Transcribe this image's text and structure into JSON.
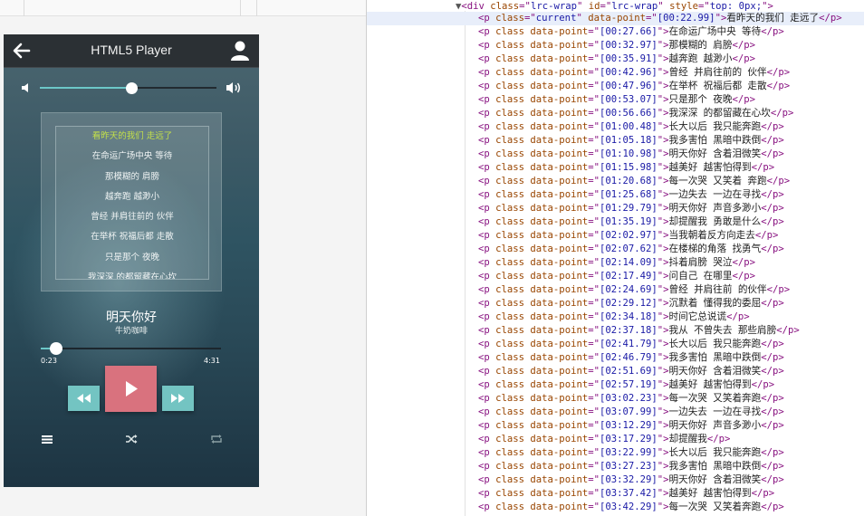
{
  "app": {
    "title": "HTML5 Player",
    "song_title": "明天你好",
    "artist": "牛奶咖啡",
    "current_time": "0:23",
    "duration": "4:31",
    "progress_fraction": 0.085,
    "volume_fraction": 0.52,
    "accent_color": "#6cc7c8",
    "play_color": "#d9727e",
    "lyric_highlight_color": "#c3e04a",
    "icons": {
      "back": "arrow-left-icon",
      "user": "user-icon",
      "volume_low": "volume-low-icon",
      "volume_high": "volume-high-icon",
      "prev": "rewind-icon",
      "play": "play-icon",
      "next": "fast-forward-icon",
      "playlist": "list-icon",
      "shuffle": "shuffle-icon",
      "repeat": "repeat-icon"
    },
    "lyrics_visible": [
      "看昨天的我们 走远了",
      "在命运广场中央 等待",
      "那模糊的 肩膀",
      "越奔跑 越渺小",
      "曾经 并肩往前的 伙伴",
      "在举杯 祝福后都 走散",
      "只是那个 夜晚",
      "我深深 的都留藏在心坎"
    ]
  },
  "devtools": {
    "wrapper": {
      "tag": "div",
      "class_value": "lrc-wrap",
      "id_value": "lrc-wrap",
      "style_value": "top: 0px;"
    },
    "rows": [
      {
        "cls": "current",
        "time": "[00:22.99]",
        "text": "看昨天的我们 走远了"
      },
      {
        "cls": "",
        "time": "[00:27.66]",
        "text": "在命运广场中央 等待"
      },
      {
        "cls": "",
        "time": "[00:32.97]",
        "text": "那模糊的 肩膀"
      },
      {
        "cls": "",
        "time": "[00:35.91]",
        "text": "越奔跑 越渺小"
      },
      {
        "cls": "",
        "time": "[00:42.96]",
        "text": "曾经 并肩往前的 伙伴"
      },
      {
        "cls": "",
        "time": "[00:47.96]",
        "text": "在举杯 祝福后都 走散"
      },
      {
        "cls": "",
        "time": "[00:53.07]",
        "text": "只是那个 夜晚"
      },
      {
        "cls": "",
        "time": "[00:56.66]",
        "text": "我深深 的都留藏在心坎"
      },
      {
        "cls": "",
        "time": "[01:00.48]",
        "text": "长大以后 我只能奔跑"
      },
      {
        "cls": "",
        "time": "[01:05.18]",
        "text": "我多害怕 黑暗中跌倒"
      },
      {
        "cls": "",
        "time": "[01:10.98]",
        "text": "明天你好 含着泪微笑"
      },
      {
        "cls": "",
        "time": "[01:15.98]",
        "text": "越美好 越害怕得到"
      },
      {
        "cls": "",
        "time": "[01:20.68]",
        "text": "每一次哭 又笑着 奔跑"
      },
      {
        "cls": "",
        "time": "[01:25.68]",
        "text": "一边失去 一边在寻找"
      },
      {
        "cls": "",
        "time": "[01:29.79]",
        "text": "明天你好 声音多渺小"
      },
      {
        "cls": "",
        "time": "[01:35.19]",
        "text": "却提醒我 勇敢是什么"
      },
      {
        "cls": "",
        "time": "[02:02.97]",
        "text": "当我朝着反方向走去"
      },
      {
        "cls": "",
        "time": "[02:07.62]",
        "text": "在楼梯的角落 找勇气"
      },
      {
        "cls": "",
        "time": "[02:14.09]",
        "text": "抖着肩膀 哭泣"
      },
      {
        "cls": "",
        "time": "[02:17.49]",
        "text": "问自己 在哪里"
      },
      {
        "cls": "",
        "time": "[02:24.69]",
        "text": "曾经 并肩往前 的伙伴"
      },
      {
        "cls": "",
        "time": "[02:29.12]",
        "text": "沉默着 懂得我的委屈"
      },
      {
        "cls": "",
        "time": "[02:34.18]",
        "text": "时间它总说谎"
      },
      {
        "cls": "",
        "time": "[02:37.18]",
        "text": "我从 不曾失去 那些肩膀"
      },
      {
        "cls": "",
        "time": "[02:41.79]",
        "text": "长大以后 我只能奔跑"
      },
      {
        "cls": "",
        "time": "[02:46.79]",
        "text": "我多害怕 黑暗中跌倒"
      },
      {
        "cls": "",
        "time": "[02:51.69]",
        "text": "明天你好 含着泪微笑"
      },
      {
        "cls": "",
        "time": "[02:57.19]",
        "text": "越美好 越害怕得到"
      },
      {
        "cls": "",
        "time": "[03:02.23]",
        "text": "每一次哭 又笑着奔跑"
      },
      {
        "cls": "",
        "time": "[03:07.99]",
        "text": "一边失去 一边在寻找"
      },
      {
        "cls": "",
        "time": "[03:12.29]",
        "text": "明天你好 声音多渺小"
      },
      {
        "cls": "",
        "time": "[03:17.29]",
        "text": "却提醒我"
      },
      {
        "cls": "",
        "time": "[03:22.99]",
        "text": "长大以后 我只能奔跑"
      },
      {
        "cls": "",
        "time": "[03:27.23]",
        "text": "我多害怕 黑暗中跌倒"
      },
      {
        "cls": "",
        "time": "[03:32.29]",
        "text": "明天你好 含着泪微笑"
      },
      {
        "cls": "",
        "time": "[03:37.42]",
        "text": "越美好 越害怕得到"
      },
      {
        "cls": "",
        "time": "[03:42.29]",
        "text": "每一次哭 又笑着奔跑"
      }
    ]
  }
}
